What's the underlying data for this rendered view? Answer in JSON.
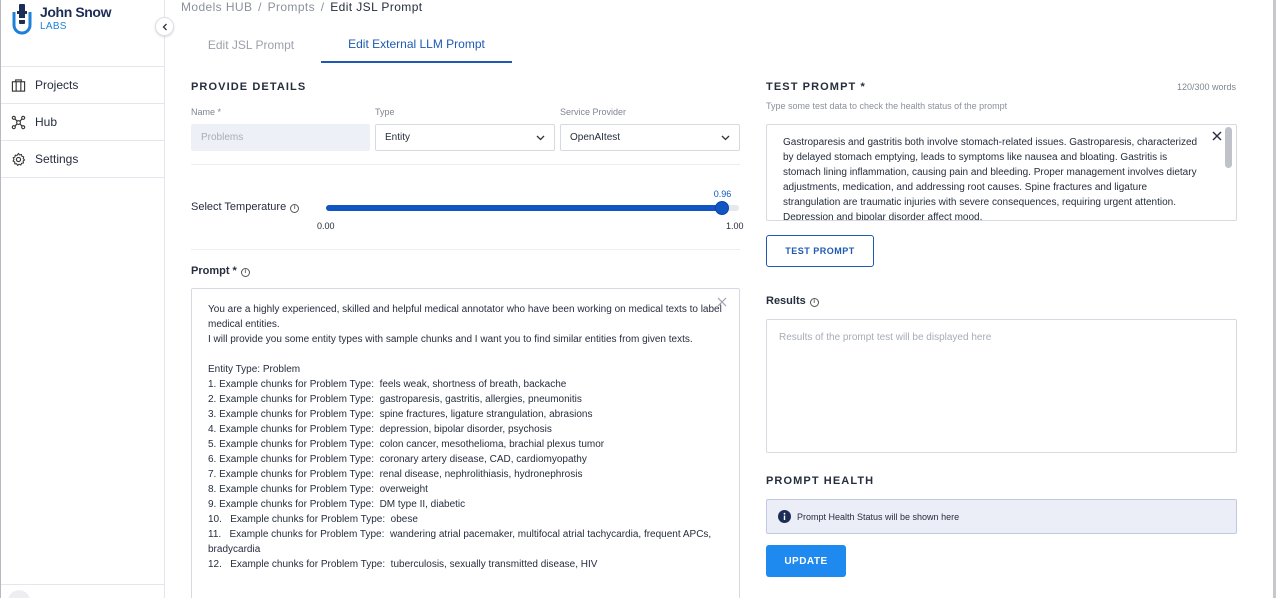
{
  "brand": {
    "name_line1": "John Snow",
    "name_line2": "LABS",
    "color_primary": "#1c2e57",
    "color_accent": "#1e80d9"
  },
  "sidebar": {
    "collapse_icon": "chevron-left-icon",
    "items": [
      {
        "label": "Projects",
        "icon": "projects-icon"
      },
      {
        "label": "Hub",
        "icon": "hub-icon"
      },
      {
        "label": "Settings",
        "icon": "gear-icon"
      }
    ]
  },
  "breadcrumb": {
    "items": [
      "Models HUB",
      "Prompts",
      "Edit JSL Prompt"
    ],
    "separator": "/"
  },
  "tabs": [
    {
      "label": "Edit JSL Prompt",
      "active": false
    },
    {
      "label": "Edit External LLM Prompt",
      "active": true
    }
  ],
  "details": {
    "title": "PROVIDE DETAILS",
    "name_label": "Name *",
    "name_placeholder": "Problems",
    "type_label": "Type",
    "type_value": "Entity",
    "provider_label": "Service Provider",
    "provider_value": "OpenAItest"
  },
  "temperature": {
    "label": "Select Temperature",
    "value": 0.96,
    "value_label": "0.96",
    "min_label": "0.00",
    "max_label": "1.00",
    "min": 0,
    "max": 1,
    "color": "#1155c2"
  },
  "prompt": {
    "label": "Prompt *",
    "text": "You are a highly experienced, skilled and helpful medical annotator who have been working on medical texts to label medical entities.\nI will provide you some entity types with sample chunks and I want you to find similar entities from given texts.\n\nEntity Type: Problem\n1. Example chunks for Problem Type:  feels weak, shortness of breath, backache\n2. Example chunks for Problem Type:  gastroparesis, gastritis, allergies, pneumonitis\n3. Example chunks for Problem Type:  spine fractures, ligature strangulation, abrasions\n4. Example chunks for Problem Type:  depression, bipolar disorder, psychosis\n5. Example chunks for Problem Type:  colon cancer, mesothelioma, brachial plexus tumor\n6. Example chunks for Problem Type:  coronary artery disease, CAD, cardiomyopathy\n7. Example chunks for Problem Type:  renal disease, nephrolithiasis, hydronephrosis\n8. Example chunks for Problem Type:  overweight\n9. Example chunks for Problem Type:  DM type II, diabetic\n10.   Example chunks for Problem Type:  obese\n11.   Example chunks for Problem Type:  wandering atrial pacemaker, multifocal atrial tachycardia, frequent APCs, bradycardia\n12.   Example chunks for Problem Type:  tuberculosis, sexually transmitted disease, HIV"
  },
  "test_prompt": {
    "title": "TEST PROMPT *",
    "word_count": "120/300 words",
    "subtitle": "Type some test data to check the health status of the prompt",
    "text": "Gastroparesis and gastritis both involve stomach-related issues. Gastroparesis, characterized by delayed stomach emptying, leads to symptoms like nausea and bloating. Gastritis is stomach lining inflammation, causing pain and bleeding. Proper management involves dietary adjustments, medication, and addressing root causes. Spine fractures and ligature strangulation are traumatic injuries with severe consequences, requiring urgent attention. Depression and bipolar disorder affect mood.",
    "button_label": "TEST PROMPT",
    "button_color": "#1e5ab3"
  },
  "results": {
    "label": "Results",
    "placeholder": "Results of the prompt test will be displayed here"
  },
  "health": {
    "title": "PROMPT HEALTH",
    "message": "Prompt Health Status will be shown here",
    "icon": "info-icon",
    "box_color": "#eceef7"
  },
  "update_button": {
    "label": "UPDATE",
    "color": "#1e8af0"
  }
}
